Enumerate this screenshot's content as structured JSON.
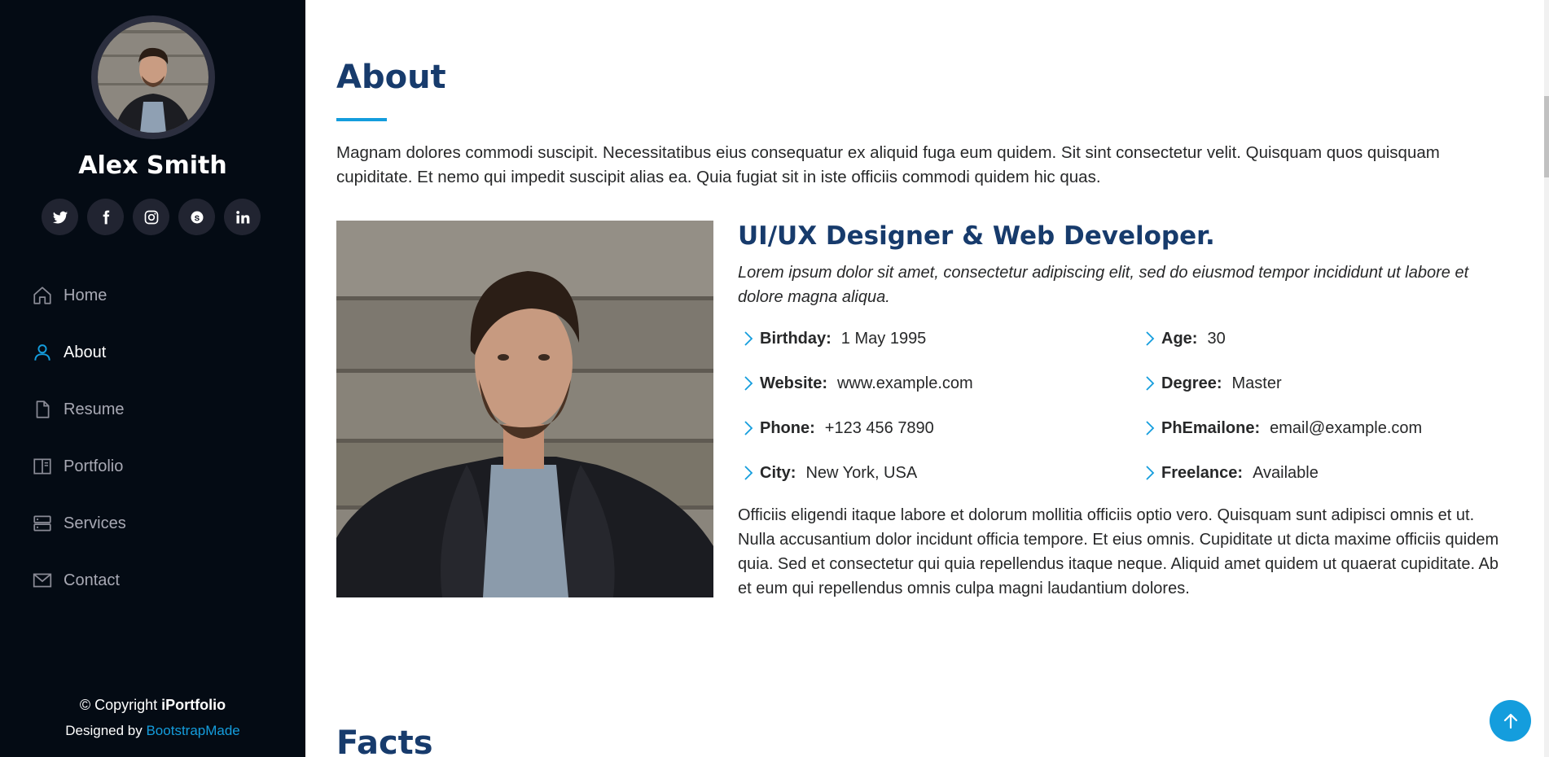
{
  "sidebar": {
    "profile_name": "Alex Smith",
    "social": [
      {
        "icon": "twitter-icon"
      },
      {
        "icon": "facebook-icon"
      },
      {
        "icon": "instagram-icon"
      },
      {
        "icon": "skype-icon"
      },
      {
        "icon": "linkedin-icon"
      }
    ],
    "nav": [
      {
        "label": "Home",
        "icon": "home-icon"
      },
      {
        "label": "About",
        "icon": "person-icon",
        "active": true
      },
      {
        "label": "Resume",
        "icon": "file-icon"
      },
      {
        "label": "Portfolio",
        "icon": "book-icon"
      },
      {
        "label": "Services",
        "icon": "server-icon"
      },
      {
        "label": "Contact",
        "icon": "envelope-icon"
      }
    ],
    "copyright_prefix": "© Copyright ",
    "copyright_brand": "iPortfolio",
    "credits_prefix": "Designed by ",
    "credits_link": "BootstrapMade"
  },
  "about": {
    "title": "About",
    "intro": "Magnam dolores commodi suscipit. Necessitatibus eius consequatur ex aliquid fuga eum quidem. Sit sint consectetur velit. Quisquam quos quisquam cupiditate. Et nemo qui impedit suscipit alias ea. Quia fugiat sit in iste officiis commodi quidem hic quas.",
    "role": "UI/UX Designer & Web Developer.",
    "tagline": "Lorem ipsum dolor sit amet, consectetur adipiscing elit, sed do eiusmod tempor incididunt ut labore et dolore magna aliqua.",
    "facts": [
      {
        "label": "Birthday:",
        "value": "1 May 1995"
      },
      {
        "label": "Age:",
        "value": "30"
      },
      {
        "label": "Website:",
        "value": "www.example.com"
      },
      {
        "label": "Degree:",
        "value": "Master"
      },
      {
        "label": "Phone:",
        "value": "+123 456 7890"
      },
      {
        "label": "PhEmailone:",
        "value": "email@example.com"
      },
      {
        "label": "City:",
        "value": "New York, USA"
      },
      {
        "label": "Freelance:",
        "value": "Available"
      }
    ],
    "outro": "Officiis eligendi itaque labore et dolorum mollitia officiis optio vero. Quisquam sunt adipisci omnis et ut. Nulla accusantium dolor incidunt officia tempore. Et eius omnis. Cupiditate ut dicta maxime officiis quidem quia. Sed et consectetur qui quia repellendus itaque neque. Aliquid amet quidem ut quaerat cupiditate. Ab et eum qui repellendus omnis culpa magni laudantium dolores."
  },
  "next_section": {
    "title": "Facts"
  },
  "colors": {
    "sidebar_bg": "#040b14",
    "accent": "#149ddd",
    "heading": "#173b6c",
    "nav_text": "#a8a9b4"
  },
  "back_to_top_icon": "arrow-up-icon"
}
